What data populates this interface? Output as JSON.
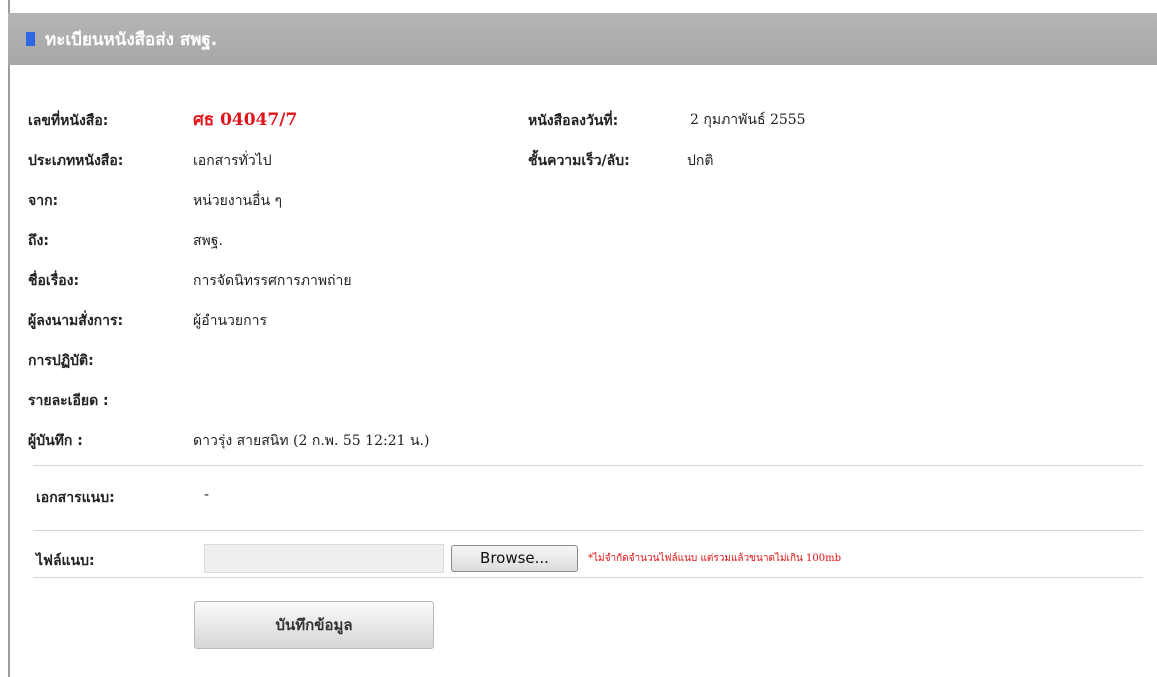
{
  "header": {
    "title": "ทะเบียนหนังสือส่ง สพฐ."
  },
  "fields": {
    "doc_no_label": "เลขที่หนังสือ:",
    "doc_no_value": "ศธ 04047/7",
    "doc_date_label": "หนังสือลงวันที่:",
    "doc_date_value": "2 กุมภาพันธ์ 2555",
    "doc_type_label": "ประเภทหนังสือ:",
    "doc_type_value": "เอกสารทั่วไป",
    "urgency_label": "ชั้นความเร็ว/ลับ:",
    "urgency_value": "ปกติ",
    "from_label": "จาก:",
    "from_value": "หน่วยงานอื่น ๆ",
    "to_label": "ถึง:",
    "to_value": "สพฐ.",
    "subject_label": "ชื่อเรื่อง:",
    "subject_value": "การจัดนิทรรศการภาพถ่าย",
    "signer_label": "ผู้ลงนามสั่งการ:",
    "signer_value": "ผู้อำนวยการ",
    "action_label": "การปฏิบัติ:",
    "detail_label": "รายละเอียด :",
    "recorder_label": "ผู้บันทึก :",
    "recorder_value": "ดาวรุ่ง สายสนิท (2 ก.พ. 55 12:21 น.)"
  },
  "attachments": {
    "label": "เอกสารแนบ:",
    "value": "-"
  },
  "upload": {
    "label": "ไฟล์แนบ:",
    "browse_label": "Browse...",
    "note": "*ไม่จำกัดจำนวนไฟล์แนบ แต่รวมแล้วขนาดไม่เกิน 100mb"
  },
  "actions": {
    "save_label": "บันทึกข้อมูล"
  },
  "colors": {
    "header_bg": "#aaaaaa",
    "accent_marker": "#2f66e6",
    "doc_no": "#e0141a",
    "note": "#e01010"
  }
}
